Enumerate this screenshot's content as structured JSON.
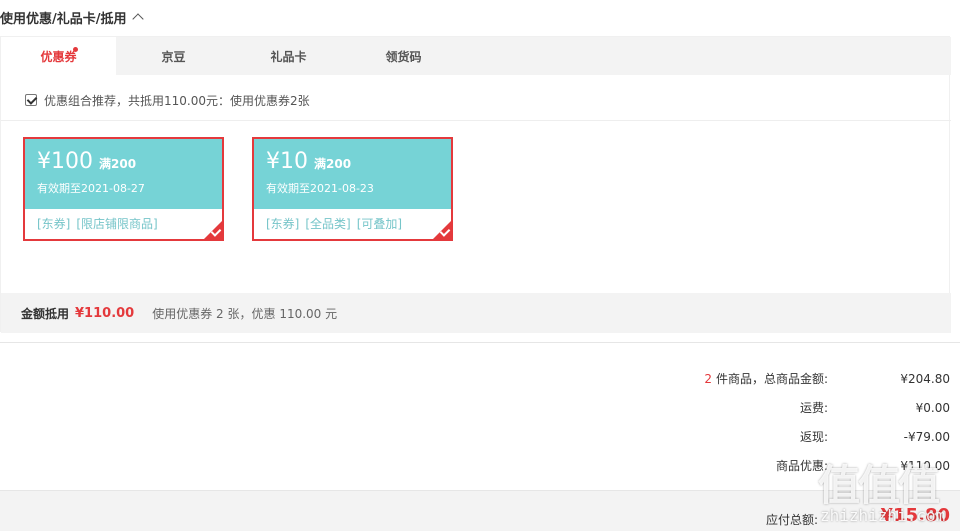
{
  "header": {
    "title": "使用优惠/礼品卡/抵用"
  },
  "tabs": [
    {
      "label": "优惠券",
      "active": true
    },
    {
      "label": "京豆"
    },
    {
      "label": "礼品卡"
    },
    {
      "label": "领货码"
    }
  ],
  "recommend": {
    "checked": true,
    "text": "优惠组合推荐，共抵用110.00元：使用优惠券2张"
  },
  "coupons": [
    {
      "amount": "¥100",
      "condition": "满200",
      "expiry": "有效期至2021-08-27",
      "tags": [
        "[东券]",
        "[限店铺限商品]"
      ]
    },
    {
      "amount": "¥10",
      "condition": "满200",
      "expiry": "有效期至2021-08-23",
      "tags": [
        "[东券]",
        "[全品类]",
        "[可叠加]"
      ]
    }
  ],
  "summary": {
    "label": "金额抵用",
    "price": "¥110.00",
    "detail": "使用优惠券 2 张，优惠 110.00 元"
  },
  "totals": {
    "count": "2",
    "goods_label": "件商品，总商品金额:",
    "goods_value": "¥204.80",
    "shipping_label": "运费:",
    "shipping_value": "¥0.00",
    "cashback_label": "返现:",
    "cashback_value": "-¥79.00",
    "discount_label": "商品优惠:",
    "discount_value": "¥110.00"
  },
  "footer": {
    "label": "应付总额:",
    "value": "¥15.80"
  },
  "watermark": {
    "glyphs": "值值值",
    "url": "zhizhizhi.com"
  },
  "colors": {
    "accent": "#e4393c",
    "coupon": "#76d3d6",
    "tag": "#76c5c9"
  }
}
